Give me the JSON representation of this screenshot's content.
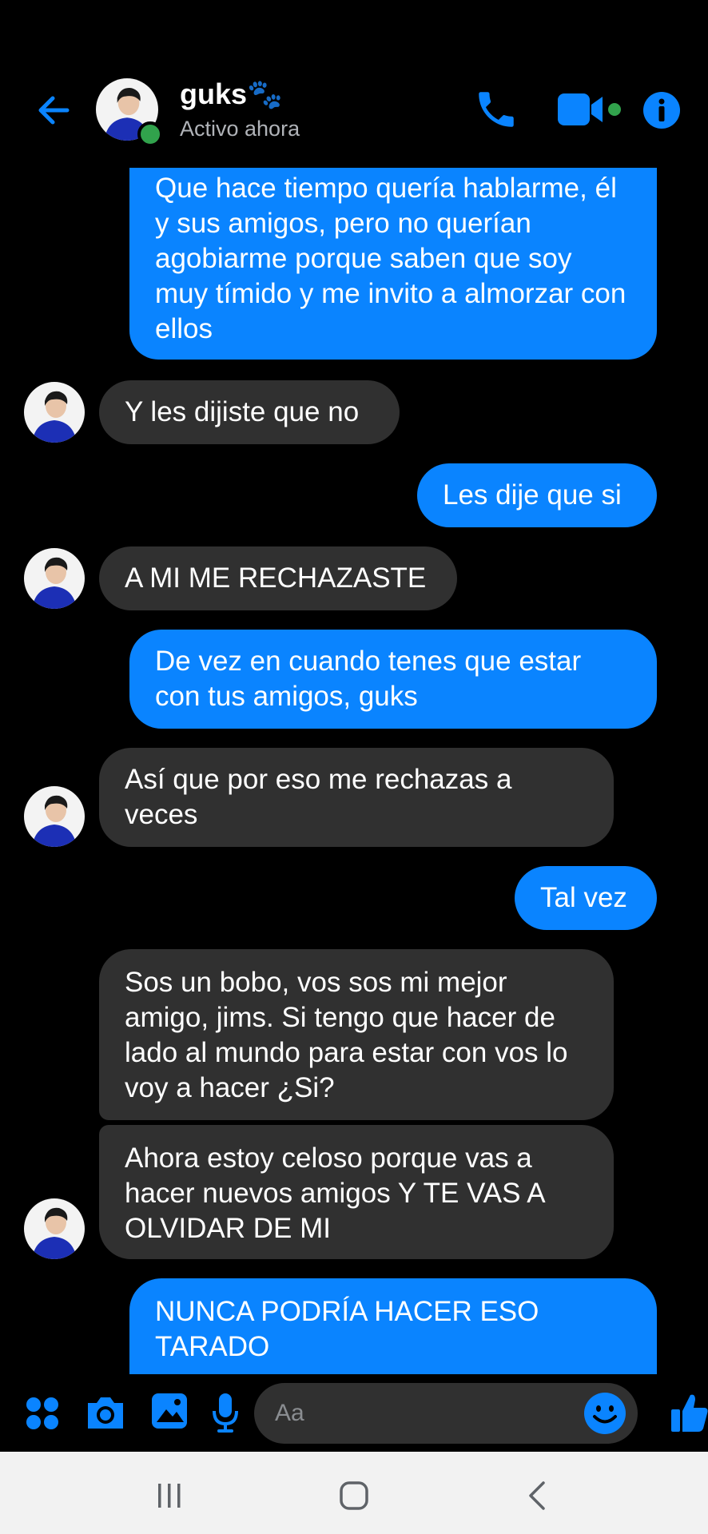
{
  "header": {
    "contact_name": "guks🐾",
    "status": "Activo ahora"
  },
  "messages": [
    {
      "sender": "me",
      "text": "Que hace tiempo quería hablarme, él y sus amigos, pero no querían agobiarme porque saben que soy muy tímido y me invito a almorzar con ellos"
    },
    {
      "sender": "them",
      "text": "Y les dijiste que no"
    },
    {
      "sender": "me",
      "text": "Les dije que si"
    },
    {
      "sender": "them",
      "text": "A MI ME RECHAZASTE"
    },
    {
      "sender": "me",
      "text": "De vez en cuando tenes que estar con tus amigos, guks"
    },
    {
      "sender": "them",
      "text": "Así que por eso me rechazas a veces"
    },
    {
      "sender": "me",
      "text": "Tal vez"
    },
    {
      "sender": "them",
      "text": "Sos un bobo, vos sos mi mejor amigo, jims. Si tengo que hacer de lado al mundo para estar con vos lo voy a hacer ¿Si?"
    },
    {
      "sender": "them",
      "text": "Ahora estoy celoso porque vas a hacer nuevos amigos Y TE VAS A OLVIDAR DE MI"
    },
    {
      "sender": "me",
      "text": "NUNCA PODRÍA HACER ESO TARADO"
    }
  ],
  "composer": {
    "placeholder": "Aa"
  },
  "colors": {
    "accent": "#0a84ff",
    "outgoing_bubble": "#0a84ff",
    "incoming_bubble": "#303030",
    "online": "#31a24c"
  },
  "icons": [
    "back-arrow-icon",
    "phone-icon",
    "video-camera-icon",
    "info-icon",
    "apps-icon",
    "camera-icon",
    "gallery-icon",
    "microphone-icon",
    "emoji-icon",
    "thumbs-up-icon",
    "recents-icon",
    "home-icon",
    "back-nav-icon"
  ]
}
